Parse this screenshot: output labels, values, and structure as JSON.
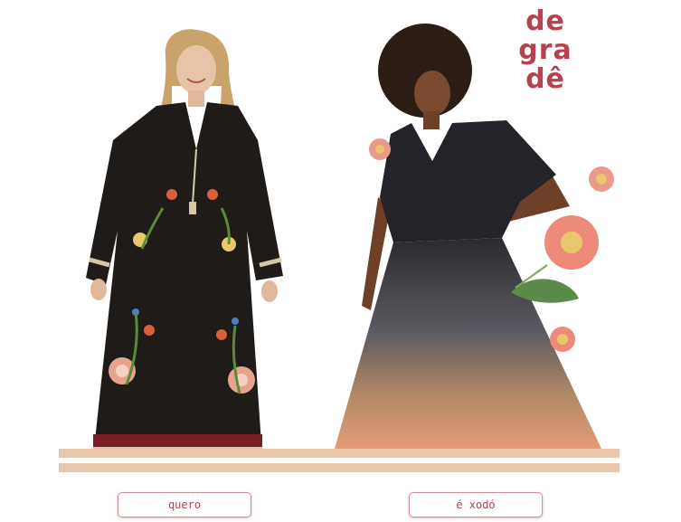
{
  "headline": {
    "line1": "de",
    "line2": "gra",
    "line3": "dê"
  },
  "buttons": {
    "left_label": "quero",
    "right_label": "é xodó"
  },
  "colors": {
    "accent": "#b8414b",
    "stripe": "#e8c8a8",
    "button_border": "#c78f92",
    "dress_left": "#1e1b18",
    "dress_right_top": "#2a2a30",
    "dress_right_bottom": "#e59a76"
  },
  "icons": {
    "flower": "flower-icon",
    "leaf": "leaf-icon"
  }
}
